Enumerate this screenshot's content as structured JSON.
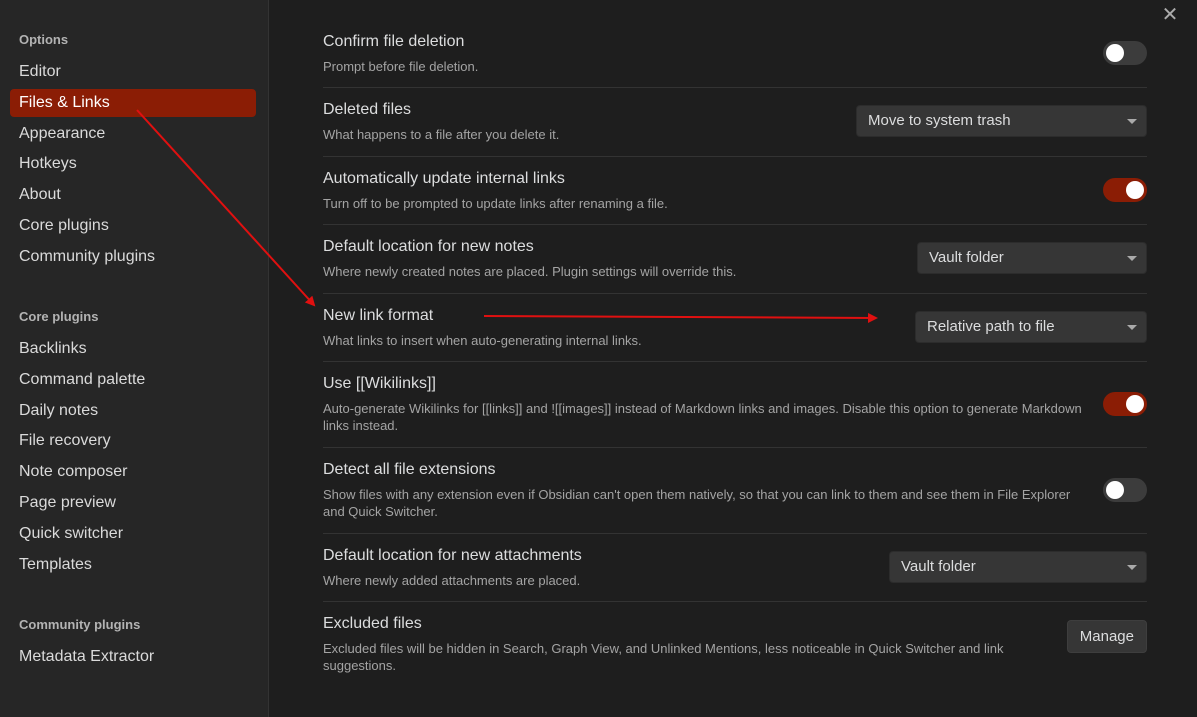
{
  "sidebar": {
    "options": {
      "heading": "Options",
      "items": [
        "Editor",
        "Files & Links",
        "Appearance",
        "Hotkeys",
        "About",
        "Core plugins",
        "Community plugins"
      ]
    },
    "core_plugins": {
      "heading": "Core plugins",
      "items": [
        "Backlinks",
        "Command palette",
        "Daily notes",
        "File recovery",
        "Note composer",
        "Page preview",
        "Quick switcher",
        "Templates"
      ]
    },
    "community_plugins": {
      "heading": "Community plugins",
      "items": [
        "Metadata Extractor"
      ]
    },
    "active_item": "Files & Links"
  },
  "close_icon": "close-icon",
  "settings": [
    {
      "name": "Confirm file deletion",
      "desc": "Prompt before file deletion.",
      "control": "toggle",
      "on": false
    },
    {
      "name": "Deleted files",
      "desc": "What happens to a file after you delete it.",
      "control": "dropdown",
      "value": "Move to system trash"
    },
    {
      "name": "Automatically update internal links",
      "desc": "Turn off to be prompted to update links after renaming a file.",
      "control": "toggle",
      "on": true
    },
    {
      "name": "Default location for new notes",
      "desc": "Where newly created notes are placed. Plugin settings will override this.",
      "control": "dropdown",
      "value": "Vault folder"
    },
    {
      "name": "New link format",
      "desc": "What links to insert when auto-generating internal links.",
      "control": "dropdown",
      "value": "Relative path to file"
    },
    {
      "name": "Use [[Wikilinks]]",
      "desc": "Auto-generate Wikilinks for [[links]] and ![[images]] instead of Markdown links and images. Disable this option to generate Markdown links instead.",
      "control": "toggle",
      "on": true
    },
    {
      "name": "Detect all file extensions",
      "desc": "Show files with any extension even if Obsidian can't open them natively, so that you can link to them and see them in File Explorer and Quick Switcher.",
      "control": "toggle",
      "on": false
    },
    {
      "name": "Default location for new attachments",
      "desc": "Where newly added attachments are placed.",
      "control": "dropdown",
      "value": "Vault folder"
    },
    {
      "name": "Excluded files",
      "desc": "Excluded files will be hidden in Search, Graph View, and Unlinked Mentions, less noticeable in Quick Switcher and link suggestions.",
      "control": "button",
      "value": "Manage"
    }
  ],
  "colors": {
    "accent": "#8b1d05",
    "annotation_arrow": "#e01010"
  }
}
